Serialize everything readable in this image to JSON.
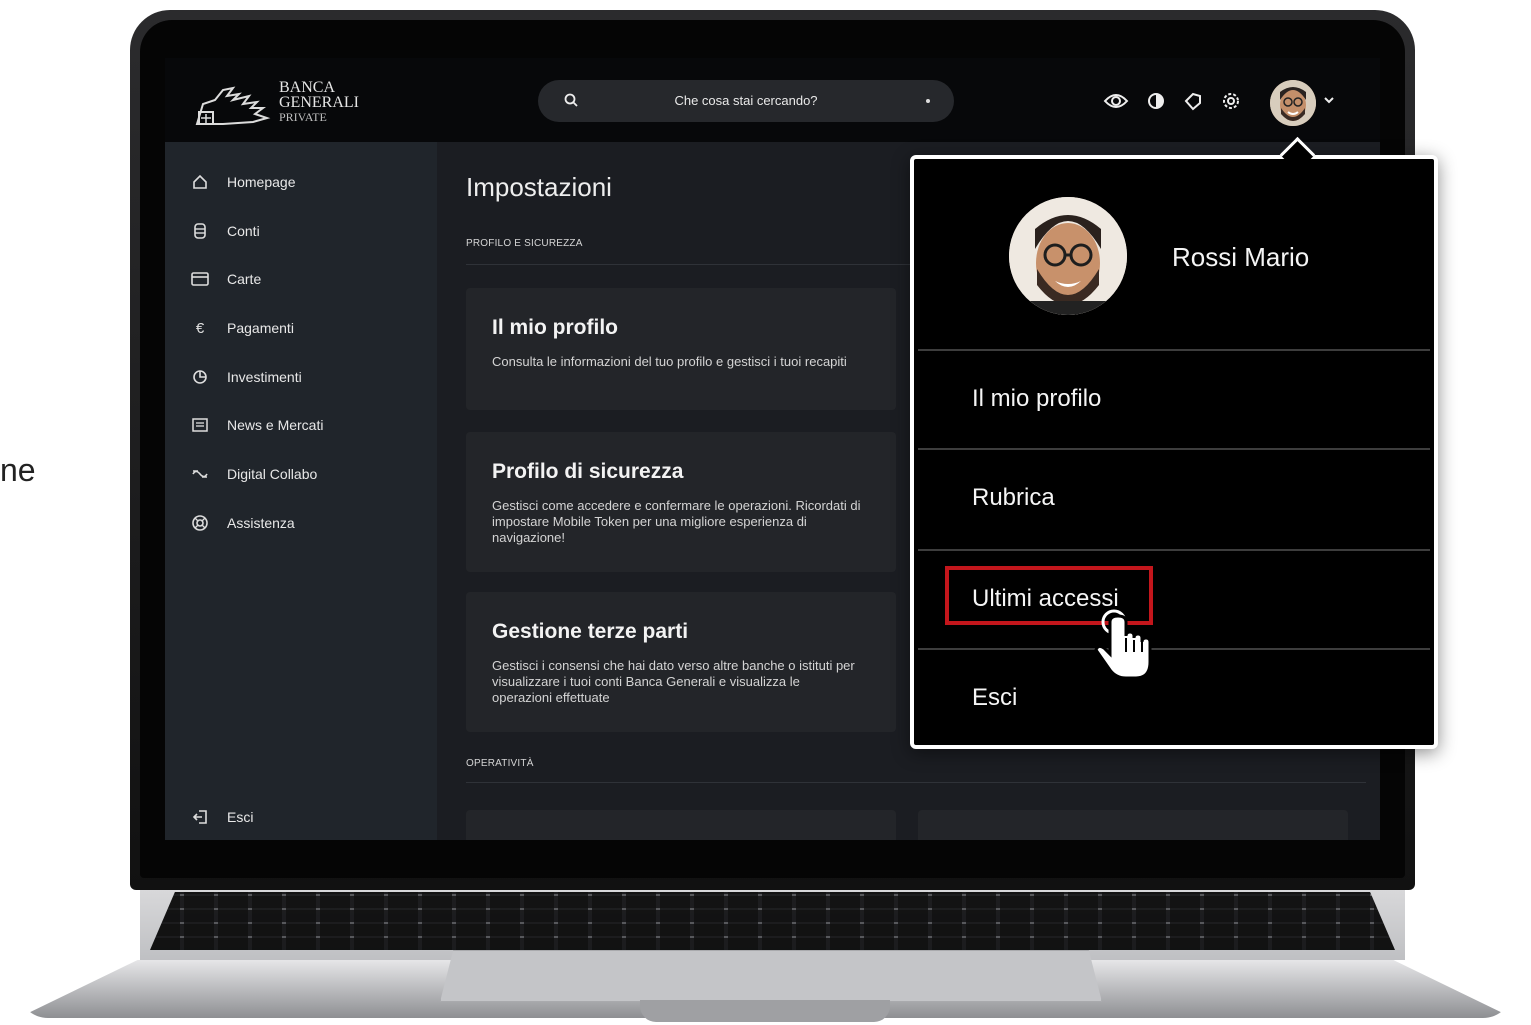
{
  "side_text": "ne",
  "logo": {
    "line1": "BANCA",
    "line2": "GENERALI",
    "line3": "PRIVATE"
  },
  "search": {
    "placeholder": "Che cosa stai cercando?",
    "icon": "search-icon"
  },
  "top_icons": [
    "eye-icon",
    "contrast-icon",
    "tag-icon",
    "gear-icon"
  ],
  "sidebar": {
    "items": [
      {
        "label": "Homepage",
        "icon": "home-icon"
      },
      {
        "label": "Conti",
        "icon": "database-icon"
      },
      {
        "label": "Carte",
        "icon": "card-icon"
      },
      {
        "label": "Pagamenti",
        "icon": "euro-icon"
      },
      {
        "label": "Investimenti",
        "icon": "pie-chart-icon"
      },
      {
        "label": "News e Mercati",
        "icon": "newspaper-icon"
      },
      {
        "label": "Digital Collabo",
        "icon": "collab-icon"
      },
      {
        "label": "Assistenza",
        "icon": "lifebuoy-icon"
      }
    ],
    "logout": "Esci"
  },
  "main": {
    "title": "Impostazioni",
    "section1": "PROFILO E SICUREZZA",
    "section2": "OPERATIVITÀ",
    "cards": [
      {
        "title": "Il mio profilo",
        "desc": "Consulta le informazioni del tuo profilo e gestisci i tuoi recapiti"
      },
      {
        "title": "Profilo di sicurezza",
        "desc": "Gestisci come accedere e confermare le operazioni. Ricordati di impostare Mobile Token per una migliore esperienza di navigazione!"
      },
      {
        "title": "Gestione terze parti",
        "desc": "Gestisci i consensi che hai dato verso altre banche o istituti per visualizzare i tuoi conti Banca Generali e visualizza le operazioni effettuate"
      }
    ]
  },
  "popup": {
    "name": "Rossi Mario",
    "items": [
      "Il mio profilo",
      "Rubrica",
      "Ultimi accessi",
      "Esci"
    ],
    "highlight_color": "#c4161c"
  }
}
